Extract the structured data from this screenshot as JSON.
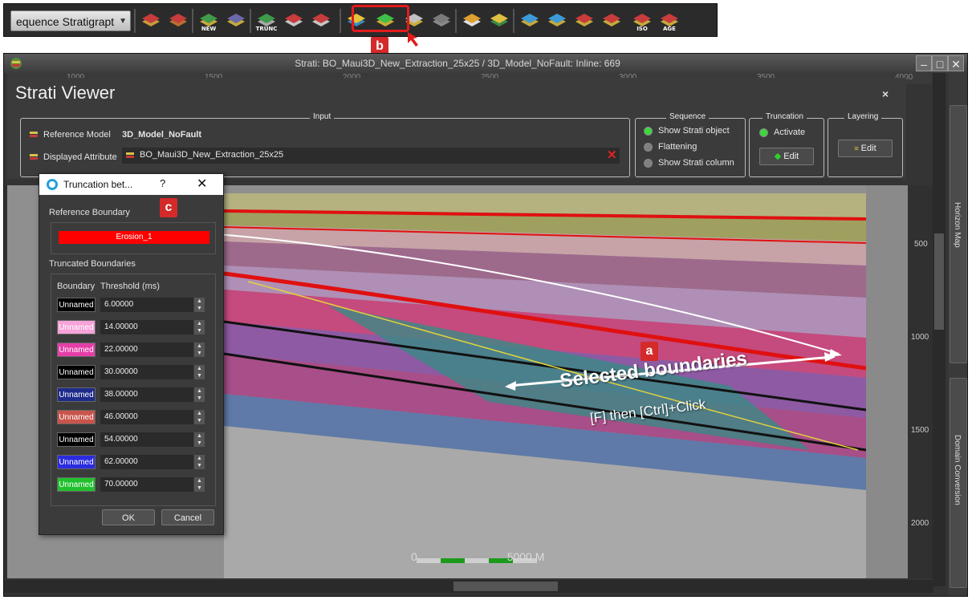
{
  "toolbar": {
    "sequence_combo": "equence Stratigrapt",
    "buttons": [
      {
        "icon": "eye-horizon-icon",
        "label": ""
      },
      {
        "icon": "eye-model-icon",
        "label": ""
      },
      {
        "icon": "new-horizon-icon",
        "label": "NEW"
      },
      {
        "icon": "edit-horizon-icon",
        "label": ""
      },
      {
        "icon": "truncation-icon",
        "label": "TRUNC"
      },
      {
        "icon": "push-up-icon",
        "label": ""
      },
      {
        "icon": "push-down-icon",
        "label": ""
      },
      {
        "icon": "truncation-edit-icon",
        "label": ""
      },
      {
        "icon": "layering-edit-icon",
        "label": ""
      },
      {
        "icon": "propagate-icon",
        "label": ""
      },
      {
        "icon": "propagate-disabled-icon",
        "label": ""
      },
      {
        "icon": "paint-bucket-icon",
        "label": ""
      },
      {
        "icon": "redo-arrow-icon",
        "label": ""
      },
      {
        "icon": "layer-stack-1-icon",
        "label": ""
      },
      {
        "icon": "layer-stack-2-icon",
        "label": ""
      },
      {
        "icon": "layer-stack-3-icon",
        "label": ""
      },
      {
        "icon": "layer-stack-4-icon",
        "label": ""
      },
      {
        "icon": "iso-icon",
        "label": "ISO"
      },
      {
        "icon": "age-icon",
        "label": "AGE"
      }
    ],
    "badge_b": "b"
  },
  "window": {
    "title": "Strati: BO_Maui3D_New_Extraction_25x25 / 3D_Model_NoFault: Inline: 669",
    "min_label": "–",
    "max_label": "□",
    "close_label": "✕"
  },
  "ruler": [
    "1000",
    "1500",
    "2000",
    "2500",
    "3000",
    "3500",
    "4000"
  ],
  "strati_viewer": {
    "title": "Strati Viewer",
    "close": "×",
    "input": {
      "group_title": "Input",
      "ref_model_label": "Reference Model",
      "ref_model_value": "3D_Model_NoFault",
      "displayed_attr_label": "Displayed Attribute",
      "displayed_attr_value": "BO_Maui3D_New_Extraction_25x25"
    },
    "sequence": {
      "group_title": "Sequence",
      "options": [
        "Show Strati object",
        "Flattening",
        "Show Strati column"
      ]
    },
    "truncation": {
      "group_title": "Truncation",
      "activate": "Activate",
      "edit": "Edit"
    },
    "layering": {
      "group_title": "Layering",
      "edit": "Edit"
    }
  },
  "side_tabs": [
    "Horizon Map",
    "Domain Conversion"
  ],
  "y_ticks": [
    "500",
    "1000",
    "1500",
    "2000"
  ],
  "overlay": {
    "badge_a": "a",
    "selected": "Selected boundaries",
    "hint": "[F] then [Ctrl]+Click",
    "scale_left": "0",
    "scale_right": "5000 M"
  },
  "dialog": {
    "title": "Truncation bet...",
    "help": "?",
    "close": "✕",
    "badge_c": "c",
    "reference_boundary_label": "Reference Boundary",
    "reference_boundary_value": "Erosion_1",
    "truncated_label": "Truncated Boundaries",
    "col_boundary": "Boundary",
    "col_threshold": "Threshold (ms)",
    "rows": [
      {
        "name": "Unnamed",
        "value": "6.00000",
        "color": "#000000"
      },
      {
        "name": "Unnamed",
        "value": "14.00000",
        "color": "#f5a3d8"
      },
      {
        "name": "Unnamed",
        "value": "22.00000",
        "color": "#e63ea8"
      },
      {
        "name": "Unnamed",
        "value": "30.00000",
        "color": "#000000"
      },
      {
        "name": "Unnamed",
        "value": "38.00000",
        "color": "#1e2b8a"
      },
      {
        "name": "Unnamed",
        "value": "46.00000",
        "color": "#c9544c"
      },
      {
        "name": "Unnamed",
        "value": "54.00000",
        "color": "#000000"
      },
      {
        "name": "Unnamed",
        "value": "62.00000",
        "color": "#2b2be0"
      },
      {
        "name": "Unnamed",
        "value": "70.00000",
        "color": "#22c02e"
      }
    ],
    "ok": "OK",
    "cancel": "Cancel"
  }
}
